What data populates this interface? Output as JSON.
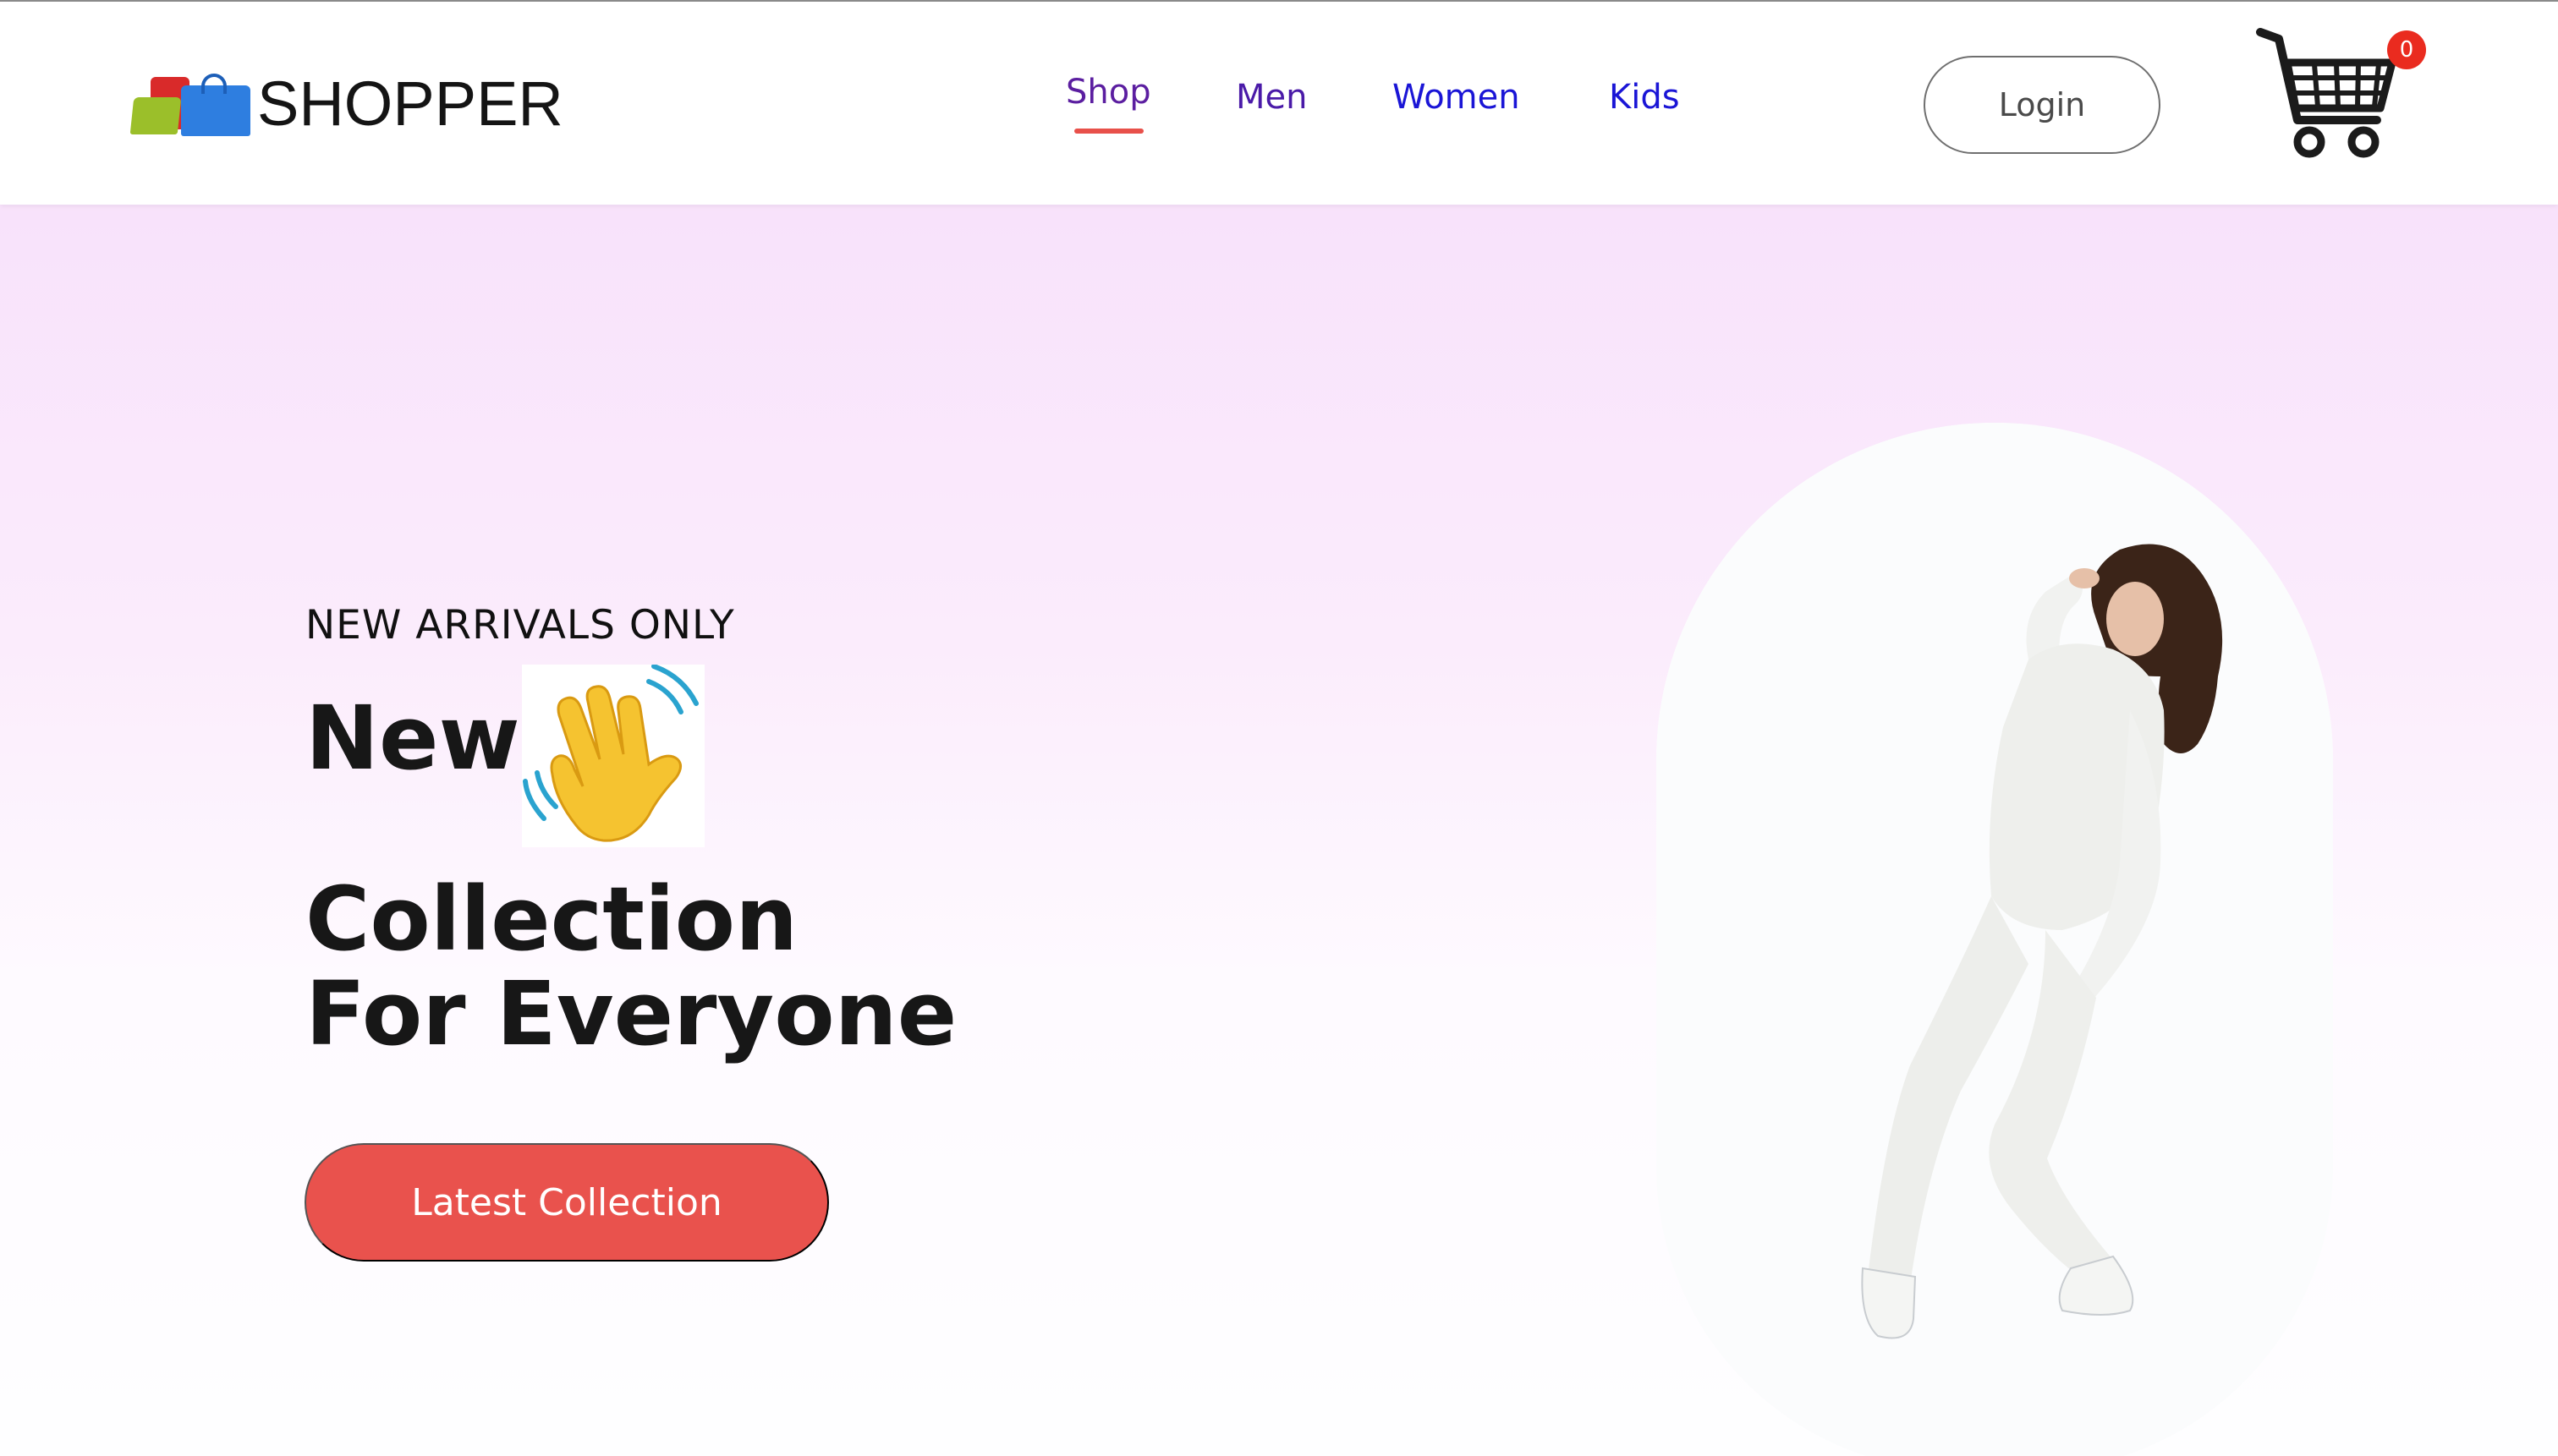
{
  "brand": {
    "name": "SHOPPER",
    "logo_icon": "shopping-bags-logo"
  },
  "nav": {
    "items": [
      {
        "label": "Shop",
        "active": true
      },
      {
        "label": "Men"
      },
      {
        "label": "Women"
      },
      {
        "label": "Kids"
      }
    ],
    "active_underline_color": "#e8504a"
  },
  "header_actions": {
    "login_label": "Login",
    "cart_icon": "cart-icon",
    "cart_count": "0",
    "cart_badge_color": "#ea2b1f"
  },
  "hero": {
    "tagline": "NEW ARRIVALS ONLY",
    "heading_word1": "New",
    "heading_line2": "Collection",
    "heading_line3": "For Everyone",
    "wave_icon": "waving-hand-icon",
    "cta_label": "Latest Collection",
    "cta_color": "#e9524d",
    "image": "model-white-outfit"
  },
  "colors": {
    "gradient_top": "#f8e2fb",
    "gradient_bottom": "#fefeff",
    "text_dark": "#171717",
    "nav_purple": "#5b1ea0",
    "nav_blue": "#1a15d6"
  }
}
